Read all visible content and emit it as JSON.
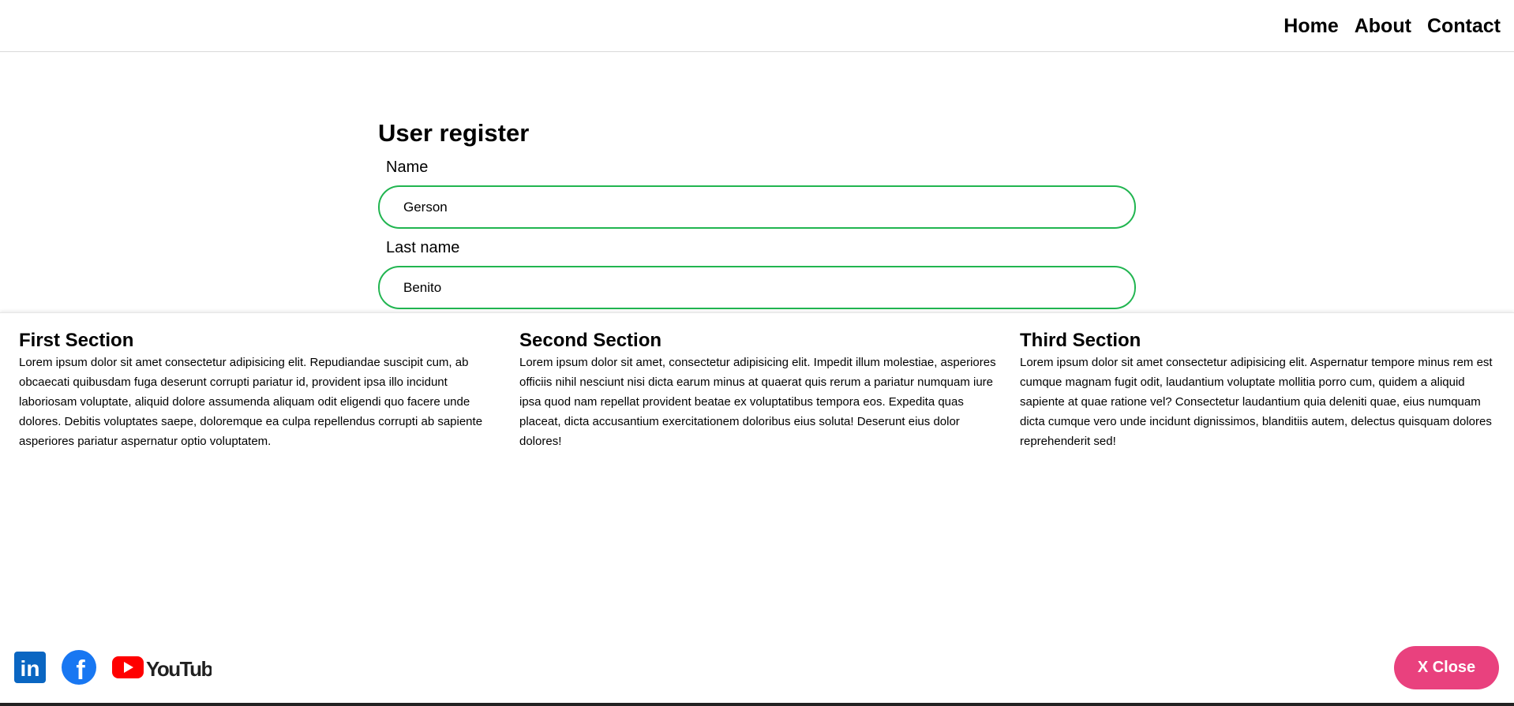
{
  "nav": {
    "items": [
      {
        "label": "Home"
      },
      {
        "label": "About"
      },
      {
        "label": "Contact"
      }
    ]
  },
  "form": {
    "title": "User register",
    "fields": [
      {
        "label": "Name",
        "value": "Gerson"
      },
      {
        "label": "Last name",
        "value": "Benito"
      }
    ]
  },
  "sections": [
    {
      "title": "First Section",
      "text": "Lorem ipsum dolor sit amet consectetur adipisicing elit. Repudiandae suscipit cum, ab obcaecati quibusdam fuga deserunt corrupti pariatur id, provident ipsa illo incidunt laboriosam voluptate, aliquid dolore assumenda aliquam odit eligendi quo facere unde dolores. Debitis voluptates saepe, doloremque ea culpa repellendus corrupti ab sapiente asperiores pariatur aspernatur optio voluptatem."
    },
    {
      "title": "Second Section",
      "text": "Lorem ipsum dolor sit amet, consectetur adipisicing elit. Impedit illum molestiae, asperiores officiis nihil nesciunt nisi dicta earum minus at quaerat quis rerum a pariatur numquam iure ipsa quod nam repellat provident beatae ex voluptatibus tempora eos. Expedita quas placeat, dicta accusantium exercitationem doloribus eius soluta! Deserunt eius dolor dolores!"
    },
    {
      "title": "Third Section",
      "text": "Lorem ipsum dolor sit amet consectetur adipisicing elit. Aspernatur tempore minus rem est cumque magnam fugit odit, laudantium voluptate mollitia porro cum, quidem a aliquid sapiente at quae ratione vel? Consectetur laudantium quia deleniti quae, eius numquam dicta cumque vero unde incidunt dignissimos, blanditiis autem, delectus quisquam dolores reprehenderit sed!"
    }
  ],
  "socials": {
    "linkedin": {
      "icon": "linkedin-icon",
      "text": "in",
      "color": "#0a66c2"
    },
    "facebook": {
      "icon": "facebook-icon",
      "text": "f",
      "color": "#1877f2"
    },
    "youtube": {
      "icon": "youtube-icon",
      "text": "YouTube",
      "color": "#ff0000"
    }
  },
  "close_button": {
    "label": "X Close",
    "color": "#e9417e"
  },
  "colors": {
    "input_border": "#21b550",
    "accent_pink": "#e9417e"
  }
}
